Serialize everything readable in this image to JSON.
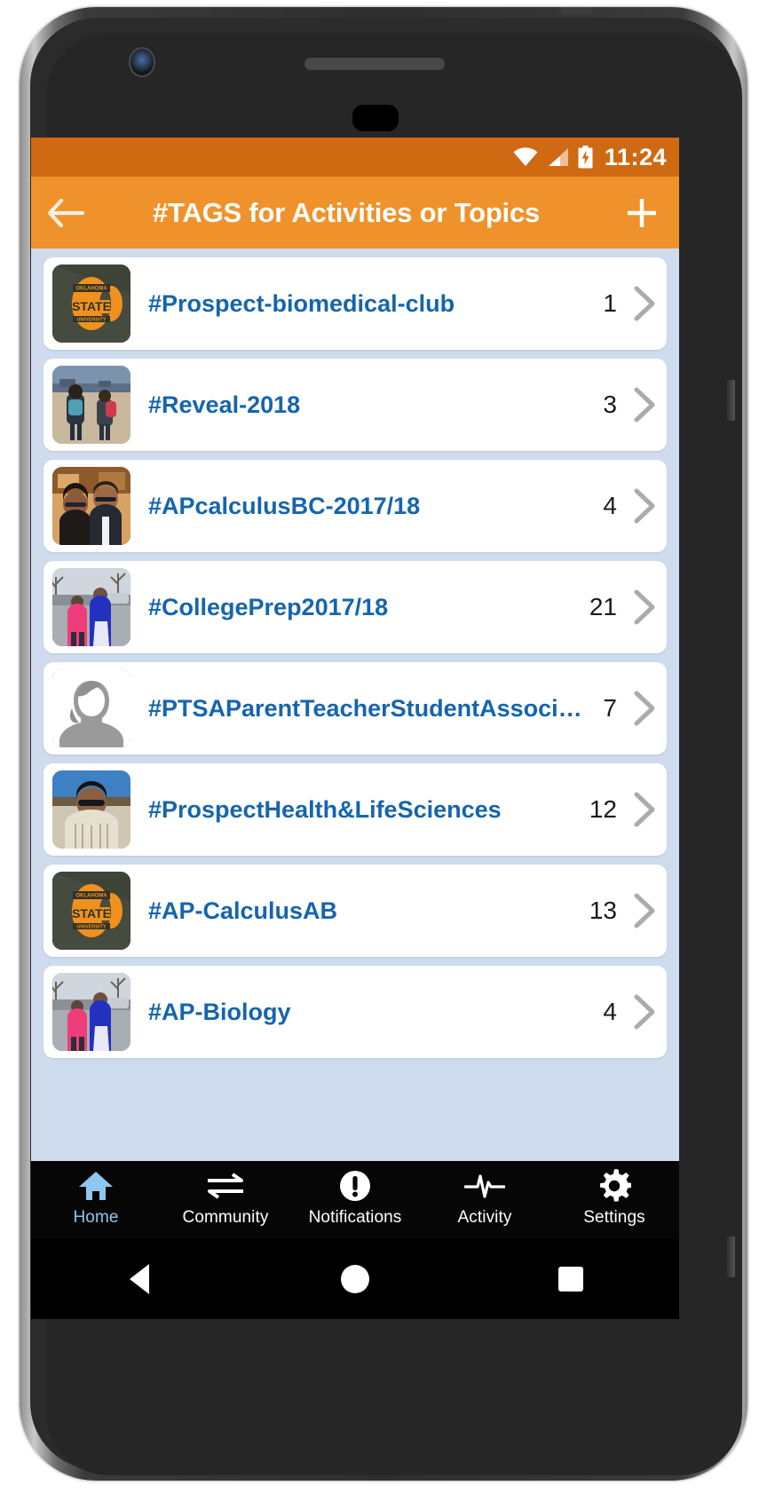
{
  "status_bar": {
    "time": "11:24",
    "icons": [
      "wifi-icon",
      "cellular-signal-icon",
      "battery-charging-icon"
    ],
    "background_color": "#cf6a13"
  },
  "app_bar": {
    "title": "#TAGS for Activities or Topics",
    "back_icon": "back-arrow-icon",
    "add_icon": "plus-icon",
    "background_color": "#f0922b",
    "title_color": "#ffffff"
  },
  "list": {
    "accent_color": "#1565ad",
    "background_color": "#cfdcee",
    "chevron_icon": "chevron-right-icon",
    "items": [
      {
        "label": "#Prospect-biomedical-club",
        "count": "1",
        "thumb": "osu-logo-photo"
      },
      {
        "label": "#Reveal-2018",
        "count": "3",
        "thumb": "children-beach-photo"
      },
      {
        "label": "#APcalculusBC-2017/18",
        "count": "4",
        "thumb": "couple-selfie-photo"
      },
      {
        "label": "#CollegePrep2017/18",
        "count": "21",
        "thumb": "two-people-outdoor-photo"
      },
      {
        "label": "#PTSAParentTeacherStudentAssoci…",
        "count": "7",
        "thumb": "default-avatar-silhouette"
      },
      {
        "label": "#ProspectHealth&LifeSciences",
        "count": "12",
        "thumb": "man-sunglasses-photo"
      },
      {
        "label": "#AP-CalculusAB",
        "count": "13",
        "thumb": "osu-logo-photo"
      },
      {
        "label": "#AP-Biology",
        "count": "4",
        "thumb": "two-people-outdoor-photo"
      }
    ]
  },
  "bottom_nav": {
    "active": "Home",
    "active_color": "#8ec6f0",
    "items": [
      {
        "label": "Home",
        "icon": "home-icon"
      },
      {
        "label": "Community",
        "icon": "exchange-arrows-icon"
      },
      {
        "label": "Notifications",
        "icon": "exclamation-circle-icon"
      },
      {
        "label": "Activity",
        "icon": "heartbeat-pulse-icon"
      },
      {
        "label": "Settings",
        "icon": "gear-icon"
      }
    ]
  },
  "system_nav": {
    "items": [
      {
        "name": "back",
        "icon": "triangle-back-icon"
      },
      {
        "name": "home",
        "icon": "circle-home-icon"
      },
      {
        "name": "recents",
        "icon": "square-recents-icon"
      }
    ]
  }
}
